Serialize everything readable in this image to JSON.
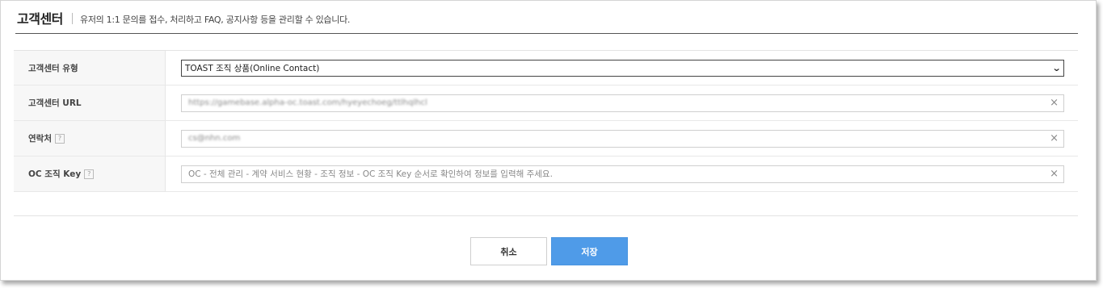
{
  "header": {
    "title": "고객센터",
    "description": "유저의 1:1 문의를 접수, 처리하고 FAQ, 공지사항 등을 관리할 수 있습니다."
  },
  "form": {
    "type": {
      "label": "고객센터 유형",
      "selected": "TOAST 조직 상품(Online Contact)"
    },
    "url": {
      "label": "고객센터 URL",
      "value": "https://gamebase.alpha-oc.toast.com/hyeyechoeg/ttlhqlhcl"
    },
    "contact": {
      "label": "연락처",
      "help": "?",
      "value": "cs@nhn.com"
    },
    "org_key": {
      "label": "OC 조직 Key",
      "help": "?",
      "placeholder": "OC - 전체 관리 - 계약 서비스 현황 - 조직 정보 - OC 조직 Key 순서로 확인하여 정보를 입력해 주세요."
    },
    "clear_glyph": "×",
    "dropdown_glyph": "⌄"
  },
  "buttons": {
    "cancel": "취소",
    "save": "저장",
    "save_color": "#4f9be8"
  }
}
